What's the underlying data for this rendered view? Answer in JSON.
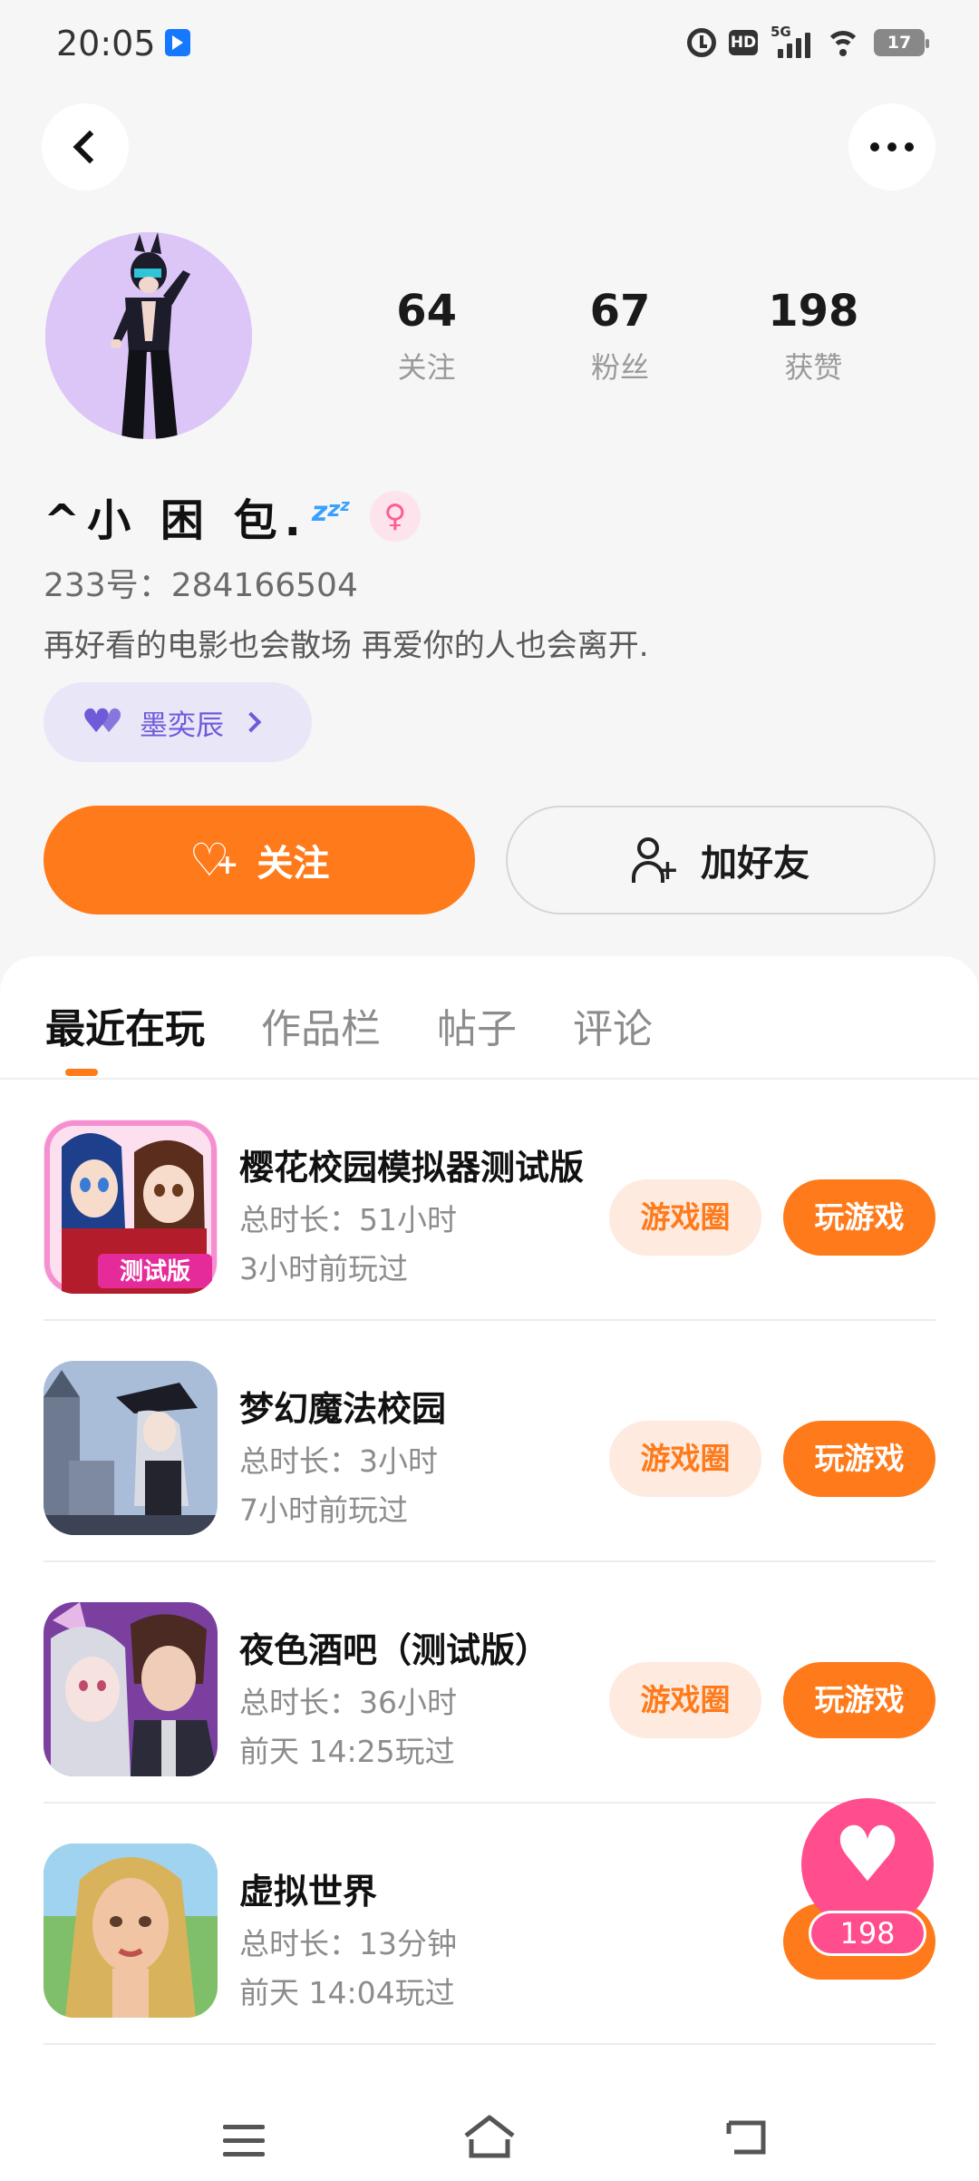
{
  "status_bar": {
    "time": "20:05",
    "network": "5G",
    "hd": "HD",
    "battery": "17"
  },
  "profile": {
    "username": "^小 困 包.",
    "zzz": "z",
    "id_label": "233号：",
    "id_value": "284166504",
    "bio": "再好看的电影也会散场 再爱你的人也会离开.",
    "cp_name": "墨奕辰",
    "gender_symbol": "♀",
    "stats": [
      {
        "value": "64",
        "label": "关注"
      },
      {
        "value": "67",
        "label": "粉丝"
      },
      {
        "value": "198",
        "label": "获赞"
      }
    ]
  },
  "actions": {
    "follow_label": "关注",
    "add_friend_label": "加好友"
  },
  "tabs": [
    "最近在玩",
    "作品栏",
    "帖子",
    "评论"
  ],
  "games": [
    {
      "title": "樱花校园模拟器测试版",
      "duration": "总时长：51小时",
      "last_played": "3小时前玩过",
      "circle_label": "游戏圈",
      "play_label": "玩游戏",
      "icon_label": "测试版"
    },
    {
      "title": "梦幻魔法校园",
      "duration": "总时长：3小时",
      "last_played": "7小时前玩过",
      "circle_label": "游戏圈",
      "play_label": "玩游戏"
    },
    {
      "title": "夜色酒吧（测试版）",
      "duration": "总时长：36小时",
      "last_played": "前天 14:25玩过",
      "circle_label": "游戏圈",
      "play_label": "玩游戏"
    },
    {
      "title": "虚拟世界",
      "duration": "总时长：13分钟",
      "last_played": "前天 14:04玩过",
      "circle_label": "",
      "play_label": ""
    }
  ],
  "like_float": {
    "count": "198"
  },
  "colors": {
    "accent": "#ff7a1a",
    "accent_light": "#feeadf",
    "like_pink": "#ff4d8d",
    "cp_purple": "#6f5bd8"
  }
}
